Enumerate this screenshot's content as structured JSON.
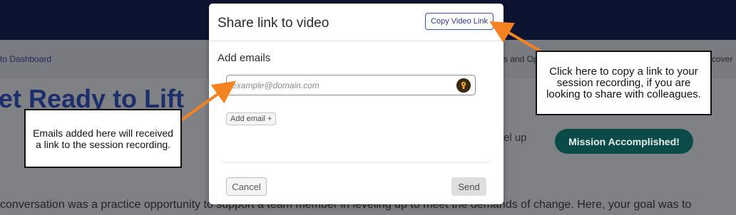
{
  "background": {
    "back_link": "to Dashboard",
    "nav_mid": "s and Op",
    "nav_right": "cover",
    "headline": "et Ready to Lift",
    "level_up": "el up",
    "mission_button": "Mission Accomplished!",
    "paragraph": "conversation was a practice opportunity to support a team member in leveling up to meet the demands of change. Here, your goal was to"
  },
  "modal": {
    "title": "Share link to video",
    "copy_button": "Copy Video Link",
    "add_emails_label": "Add emails",
    "email_placeholder": "example@domain.com",
    "add_email_button": "Add email +",
    "cancel_button": "Cancel",
    "send_button": "Send"
  },
  "callouts": {
    "copy_link_note": "Click here to copy a link to your session recording, if you are looking to share with colleagues.",
    "emails_note": "Emails added here will received a link to the session recording."
  },
  "icons": {
    "email_field_icon": "key-icon",
    "arrow_color": "#f58220"
  }
}
